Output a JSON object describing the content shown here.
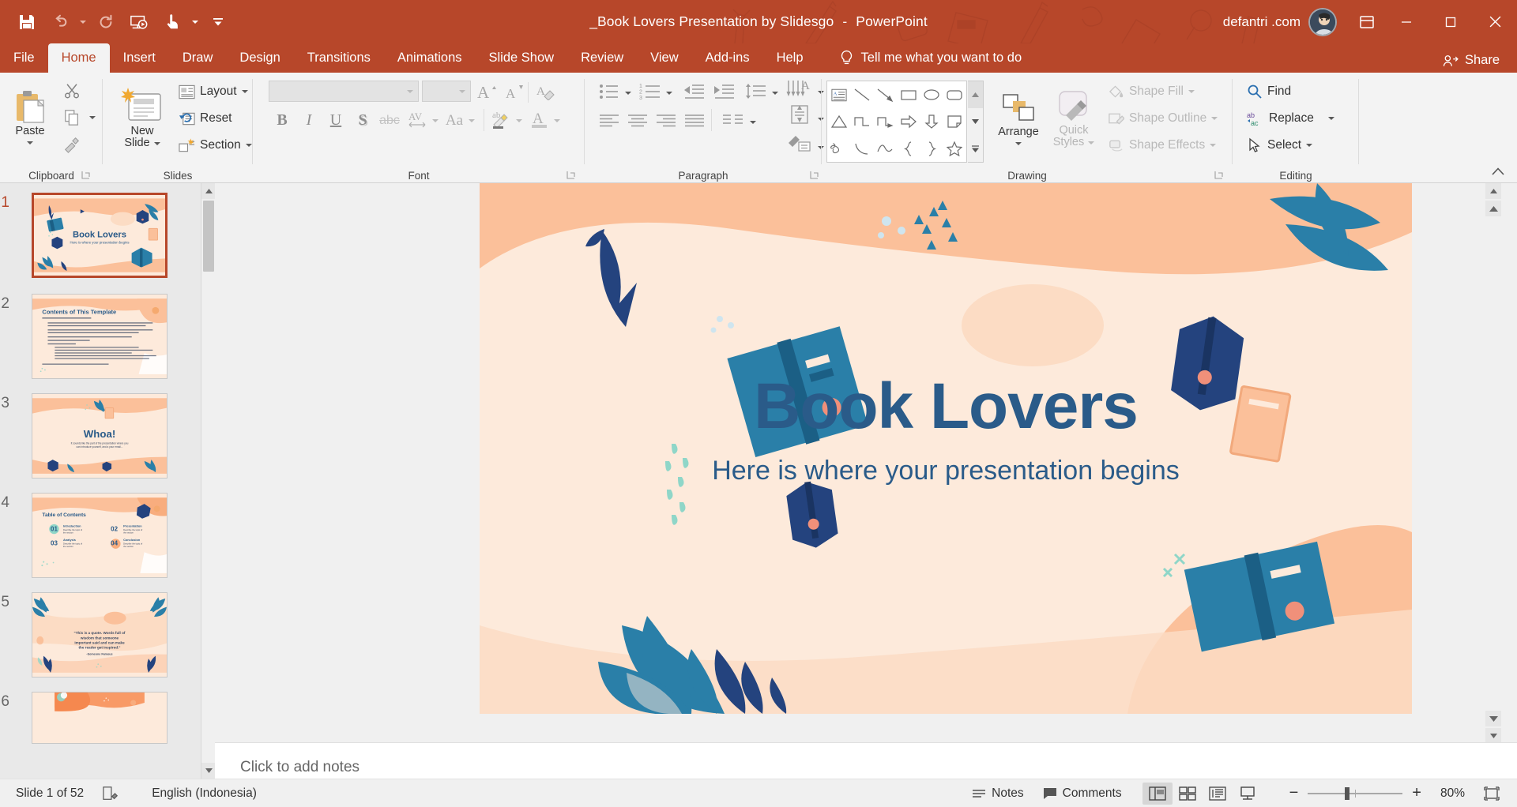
{
  "window": {
    "title": "_Book Lovers Presentation by Slidesgo",
    "separator": "-",
    "app_name": "PowerPoint",
    "user": "defantri .com",
    "accent_color": "#b7472a",
    "quick_access": [
      {
        "name": "save",
        "label": "Save"
      },
      {
        "name": "undo",
        "label": "Undo"
      },
      {
        "name": "redo",
        "label": "Redo"
      },
      {
        "name": "start-from-beginning",
        "label": "Start From Beginning"
      },
      {
        "name": "touch-mouse-mode",
        "label": "Touch/Mouse Mode"
      },
      {
        "name": "customize-qat",
        "label": "Customize Quick Access Toolbar"
      }
    ],
    "controls": {
      "ribbon_display": "Ribbon Display Options",
      "minimize": "Minimize",
      "restore": "Restore Down",
      "close": "Close"
    }
  },
  "tabs": [
    {
      "label": "File",
      "active": false
    },
    {
      "label": "Home",
      "active": true
    },
    {
      "label": "Insert",
      "active": false
    },
    {
      "label": "Draw",
      "active": false
    },
    {
      "label": "Design",
      "active": false
    },
    {
      "label": "Transitions",
      "active": false
    },
    {
      "label": "Animations",
      "active": false
    },
    {
      "label": "Slide Show",
      "active": false
    },
    {
      "label": "Review",
      "active": false
    },
    {
      "label": "View",
      "active": false
    },
    {
      "label": "Add-ins",
      "active": false
    },
    {
      "label": "Help",
      "active": false
    }
  ],
  "tellme": {
    "label": "Tell me what you want to do",
    "icon": "lightbulb-icon"
  },
  "share": {
    "label": "Share",
    "icon": "share-person-icon"
  },
  "ribbon": {
    "groups": [
      {
        "label": "Clipboard",
        "dialog_launcher": true
      },
      {
        "label": "Slides",
        "dialog_launcher": false
      },
      {
        "label": "Font",
        "dialog_launcher": true
      },
      {
        "label": "Paragraph",
        "dialog_launcher": true
      },
      {
        "label": "Drawing",
        "dialog_launcher": true
      },
      {
        "label": "Editing",
        "dialog_launcher": false
      }
    ],
    "clipboard": {
      "paste_label": "Paste",
      "cut_label": "Cut",
      "copy_label": "Copy",
      "format_painter_label": "Format Painter"
    },
    "slides": {
      "new_slide_label": "New\nSlide",
      "new_slide_line1": "New",
      "new_slide_line2": "Slide",
      "layout_label": "Layout",
      "reset_label": "Reset",
      "section_label": "Section"
    },
    "font": {
      "font_name_value": "",
      "font_size_value": "",
      "grow_font": "Increase Font Size",
      "shrink_font": "Decrease Font Size",
      "clear_formatting": "Clear All Formatting",
      "bold": "B",
      "italic": "I",
      "underline": "U",
      "shadow": "S",
      "strikethrough": "abc",
      "character_spacing": "AV",
      "change_case": "Aa",
      "text_highlight": "ab",
      "font_color": "A"
    },
    "paragraph": {
      "bullets": "Bullets",
      "numbering": "Numbering",
      "decrease_indent": "Decrease List Level",
      "increase_indent": "Increase List Level",
      "line_spacing": "Line Spacing",
      "text_direction": "Text Direction",
      "align_text": "Align Text",
      "align_left": "Align Left",
      "align_center": "Center",
      "align_right": "Align Right",
      "justify": "Justify",
      "columns": "Columns",
      "convert_smartart": "Convert to SmartArt"
    },
    "drawing": {
      "shapes": [
        "text-box-icon",
        "line-icon",
        "arrow-icon",
        "rectangle-icon",
        "oval-icon",
        "rounded-rectangle-icon",
        "triangle-icon",
        "elbow-connector-icon",
        "elbow-arrow-connector-icon",
        "right-arrow-icon",
        "down-arrow-icon",
        "folded-corner-icon",
        "scribble-icon",
        "arc-icon",
        "curve-icon",
        "left-brace-icon",
        "right-brace-icon",
        "star-icon"
      ],
      "arrange_label": "Arrange",
      "quick_styles_line1": "Quick",
      "quick_styles_line2": "Styles",
      "shape_fill": "Shape Fill",
      "shape_outline": "Shape Outline",
      "shape_effects": "Shape Effects"
    },
    "editing": {
      "find": "Find",
      "replace": "Replace",
      "select": "Select"
    },
    "collapse_ribbon": "Collapse the Ribbon"
  },
  "thumbnails": [
    {
      "number": "1",
      "selected": true,
      "type": "title",
      "title": "Book Lovers",
      "subtitle": "Here is where your presentation begins"
    },
    {
      "number": "2",
      "selected": false,
      "type": "content",
      "title": "Contents of This Template",
      "subtitle": ""
    },
    {
      "number": "3",
      "selected": false,
      "type": "whoa",
      "title": "Whoa!",
      "subtitle": "It sounds like the part of the presentation where you can introduce yourself and a your email..."
    },
    {
      "number": "4",
      "selected": false,
      "type": "toc",
      "title": "Table of Contents",
      "subtitle": ""
    },
    {
      "number": "5",
      "selected": false,
      "type": "quote",
      "title": "“This is a quote. Words full of wisdom that someone important said and can make the reader get inspired.”",
      "subtitle": "-Someone Famous"
    },
    {
      "number": "6",
      "selected": false,
      "type": "plain",
      "title": "",
      "subtitle": ""
    }
  ],
  "toc_items": [
    {
      "num": "01",
      "title": "Introduction",
      "desc": "Describe the topic of the section"
    },
    {
      "num": "02",
      "title": "Presentation",
      "desc": "Describe the topic of the section"
    },
    {
      "num": "03",
      "title": "Analysis",
      "desc": "Describe the topic of the section"
    },
    {
      "num": "04",
      "title": "Conclusion",
      "desc": "Describe the topic of the section"
    }
  ],
  "slide": {
    "title": "Book Lovers",
    "subtitle": "Here is where your presentation begins",
    "bg_color": "#fdeadb",
    "peach_color": "#fbc09a",
    "title_color": "#2a5b89",
    "blue_dark": "#24437e",
    "blue_mid": "#2a7fa8",
    "teal": "#7fd1c4"
  },
  "notes": {
    "placeholder": "Click to add notes"
  },
  "status": {
    "slide_counter": "Slide 1 of 52",
    "accessibility_icon": "accessibility-check-icon",
    "language": "English (Indonesia)",
    "notes_label": "Notes",
    "comments_label": "Comments",
    "views": [
      {
        "name": "normal-view",
        "active": true
      },
      {
        "name": "slide-sorter-view",
        "active": false
      },
      {
        "name": "reading-view",
        "active": false
      },
      {
        "name": "slide-show-view",
        "active": false
      }
    ],
    "zoom_out": "−",
    "zoom_in": "+",
    "zoom_level": "80%",
    "fit_slide": "Fit slide to current window"
  }
}
